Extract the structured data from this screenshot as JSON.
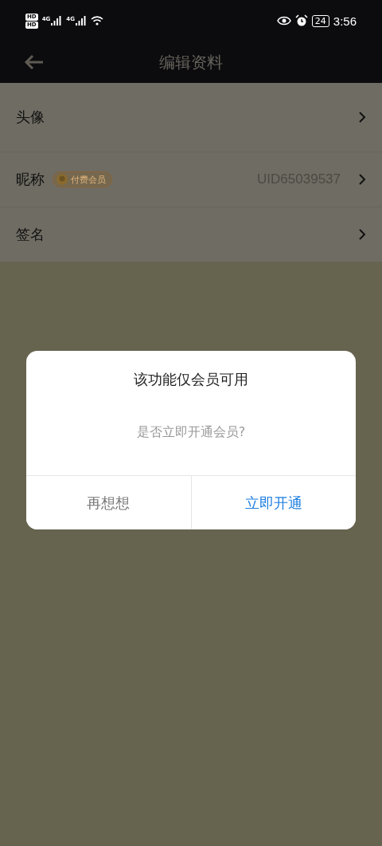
{
  "status_bar": {
    "sim_labels": [
      "HD",
      "HD"
    ],
    "network_labels": [
      "4G",
      "4G"
    ],
    "battery": "24",
    "time": "3:56"
  },
  "header": {
    "title": "编辑资料"
  },
  "rows": [
    {
      "label": "头像"
    },
    {
      "label": "昵称",
      "badge": "付费会员",
      "value": "UID65039537"
    },
    {
      "label": "签名"
    }
  ],
  "dialog": {
    "title": "该功能仅会员可用",
    "message": "是否立即开通会员?",
    "buttons": [
      {
        "label": "再想想",
        "kind": "cancel"
      },
      {
        "label": "立即开通",
        "kind": "confirm"
      }
    ]
  }
}
